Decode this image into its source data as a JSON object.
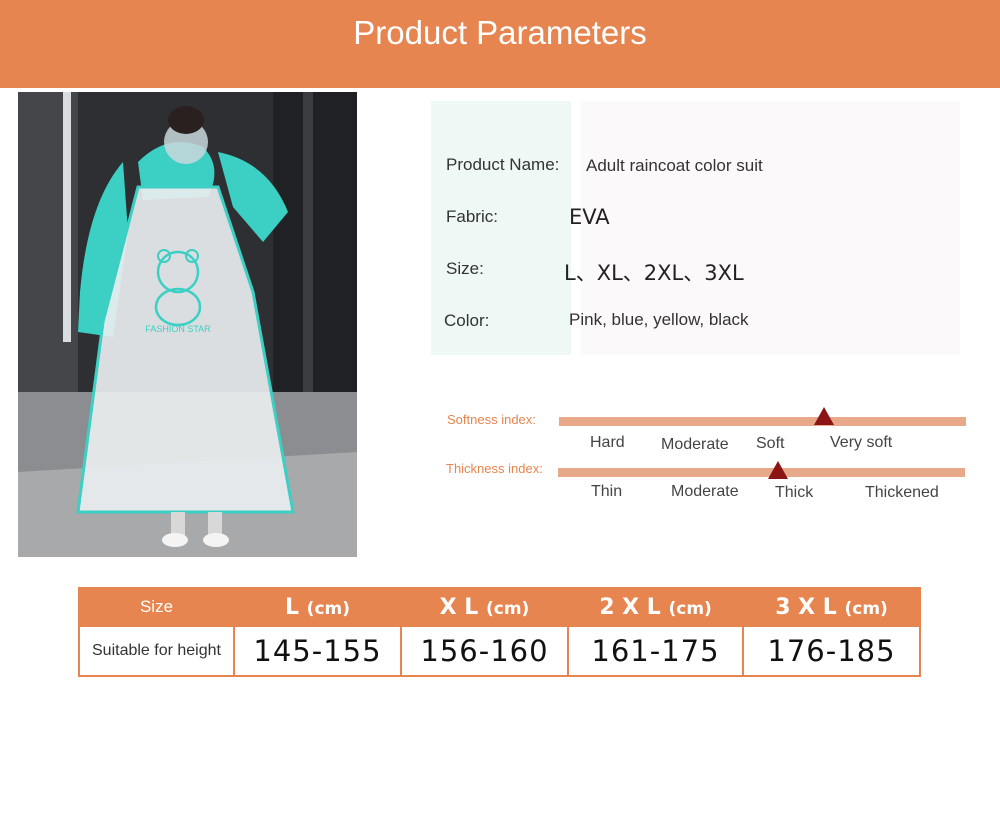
{
  "header": {
    "title": "Product Parameters"
  },
  "params": {
    "name_label": "Product Name:",
    "name_value": "Adult raincoat color suit",
    "fabric_label": "Fabric:",
    "fabric_value": "EVA",
    "size_label": "Size:",
    "size_value": "L、XL、2XL、3XL",
    "color_label": "Color:",
    "color_value": "Pink, blue, yellow, black"
  },
  "indices": {
    "softness": {
      "label": "Softness index:",
      "ticks": [
        "Hard",
        "Moderate",
        "Soft",
        "Very soft"
      ],
      "level_fraction": 0.65
    },
    "thickness": {
      "label": "Thickness index:",
      "ticks": [
        "Thin",
        "Moderate",
        "Thick",
        "Thickened"
      ],
      "level_fraction": 0.54
    }
  },
  "size_table": {
    "header_label": "Size",
    "row_label": "Suitable for height",
    "columns": [
      {
        "size": "L",
        "unit": "(cm)",
        "height": "145-155"
      },
      {
        "size": "X L",
        "unit": "(cm)",
        "height": "156-160"
      },
      {
        "size": "2 X L",
        "unit": "(cm)",
        "height": "161-175"
      },
      {
        "size": "3 X L",
        "unit": "(cm)",
        "height": "176-185"
      }
    ]
  },
  "photo": {
    "print_text": "FASHION STAR"
  },
  "colors": {
    "accent": "#e6854f",
    "bar": "#e8a98a",
    "marker": "#8b1414",
    "coat": "#3ccfc4"
  }
}
